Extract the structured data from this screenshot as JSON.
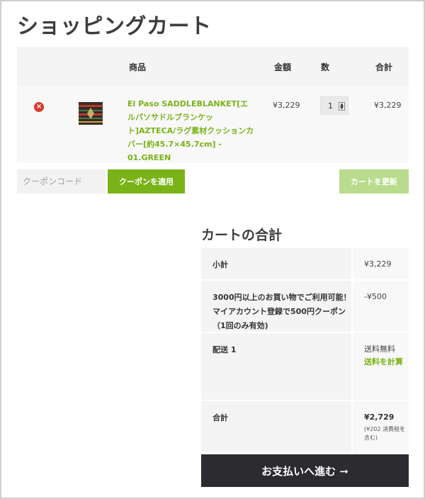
{
  "page": {
    "title": "ショッピングカート"
  },
  "table": {
    "headers": {
      "product": "商品",
      "price": "金額",
      "quantity": "数",
      "subtotal": "合計"
    },
    "items": [
      {
        "remove_icon": "×",
        "thumbnail_icon": "cushion-thumbnail",
        "name": "El Paso SADDLEBLANKET[エルパソサドルブランケット]AZTECA/ラグ素材クッションカバー[約45.7×45.7cm] - 01.GREEN",
        "price": "¥3,229",
        "quantity": "1",
        "subtotal": "¥3,229"
      }
    ]
  },
  "coupon": {
    "placeholder": "クーポンコード",
    "apply_label": "クーポンを適用"
  },
  "update_label": "カートを更新",
  "totals": {
    "title": "カートの合計",
    "subtotal_label": "小計",
    "subtotal_value": "¥3,229",
    "coupon_label": "3000円以上のお買い物でご利用可能！マイアカウント登録で500円クーポン（1回のみ有効)",
    "coupon_value": "-¥500",
    "shipping_label": "配送 1",
    "shipping_value": "送料無料",
    "shipping_calc_link": "送料を計算",
    "total_label": "合計",
    "total_value": "¥2,729",
    "tax_note": "(¥202 消費税を含む)"
  },
  "checkout": {
    "label": "お支払いへ進む ➞"
  },
  "colors": {
    "accent": "#7ab317",
    "accent_light": "#b9db8d",
    "dark": "#2b2b30",
    "remove": "#d93b2b"
  }
}
